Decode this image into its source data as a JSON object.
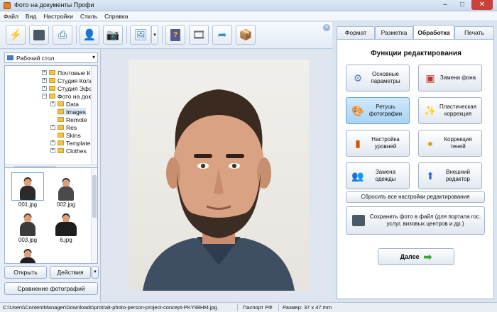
{
  "window": {
    "title": "Фото на документы Профи",
    "minimize": "–",
    "maximize": "□",
    "close": "✕"
  },
  "menu": [
    "Файл",
    "Вид",
    "Настройки",
    "Стиль",
    "Справка"
  ],
  "toolbar": {
    "icons": [
      "wizard-icon",
      "save-icon",
      "print-icon",
      "user-icon",
      "camera-icon",
      "photo-icon",
      "dropdown-icon",
      "help-book-icon",
      "video-icon",
      "share-icon",
      "delivery-icon"
    ],
    "close_panel": "✕"
  },
  "left": {
    "folder": "Рабочий стол",
    "tree": [
      {
        "label": "Почтовые К",
        "expander": "+"
      },
      {
        "label": "Студия Колл",
        "expander": "+"
      },
      {
        "label": "Студия Эфф",
        "expander": "+"
      },
      {
        "label": "Фото на док",
        "expander": "−"
      },
      {
        "label": "Data",
        "expander": "+"
      },
      {
        "label": "Images",
        "expander": ""
      },
      {
        "label": "Remote",
        "expander": ""
      },
      {
        "label": "Res",
        "expander": "+"
      },
      {
        "label": "Skins",
        "expander": ""
      },
      {
        "label": "Templates",
        "expander": "+"
      },
      {
        "label": "Clothes",
        "expander": "+"
      }
    ],
    "thumbnails": [
      "001.jpg",
      "002.jpg",
      "003.jpg",
      "6.jpg",
      ""
    ],
    "open_button": "Открыть",
    "actions_button": "Действия",
    "actions_dropdown": "▾",
    "compare_button": "Сравнение фотографий"
  },
  "tabs": [
    "Формат",
    "Разметка",
    "Обработка",
    "Печать"
  ],
  "active_tab": 2,
  "panel": {
    "heading": "Функции редактирования",
    "functions": [
      {
        "label": "Основные параметры",
        "icon": "sliders-icon",
        "glyph": "⚙"
      },
      {
        "label": "Замена фона",
        "icon": "background-icon",
        "glyph": "▣"
      },
      {
        "label": "Ретушь фотографии",
        "icon": "retouch-icon",
        "glyph": "🎨"
      },
      {
        "label": "Пластическая коррекция",
        "icon": "magic-wand-icon",
        "glyph": "✨"
      },
      {
        "label": "Настройка уровней",
        "icon": "levels-icon",
        "glyph": "▮"
      },
      {
        "label": "Коррекция теней",
        "icon": "shadow-icon",
        "glyph": "●"
      },
      {
        "label": "Замена одежды",
        "icon": "clothes-icon",
        "glyph": "👥"
      },
      {
        "label": "Внешний редактор",
        "icon": "external-editor-icon",
        "glyph": "⬆"
      }
    ],
    "reset_label": "Сбросить все настройки редактирования",
    "save_label": "Сохранить фото в файл (для портала гос. услуг, визовых центров и др.)",
    "next_label": "Далее",
    "next_arrow": "➡"
  },
  "status": {
    "path": "C:\\Users\\ContentManager\\Downloads\\protrait-photo-person-project-concept-PKY98HM.jpg",
    "doc_type": "Паспорт РФ",
    "size": "Размер: 37 x 47 mm"
  },
  "colors": {
    "selected_function": "#a8d3f3",
    "next_arrow": "#3aa832",
    "folder": "#f1c24a"
  }
}
